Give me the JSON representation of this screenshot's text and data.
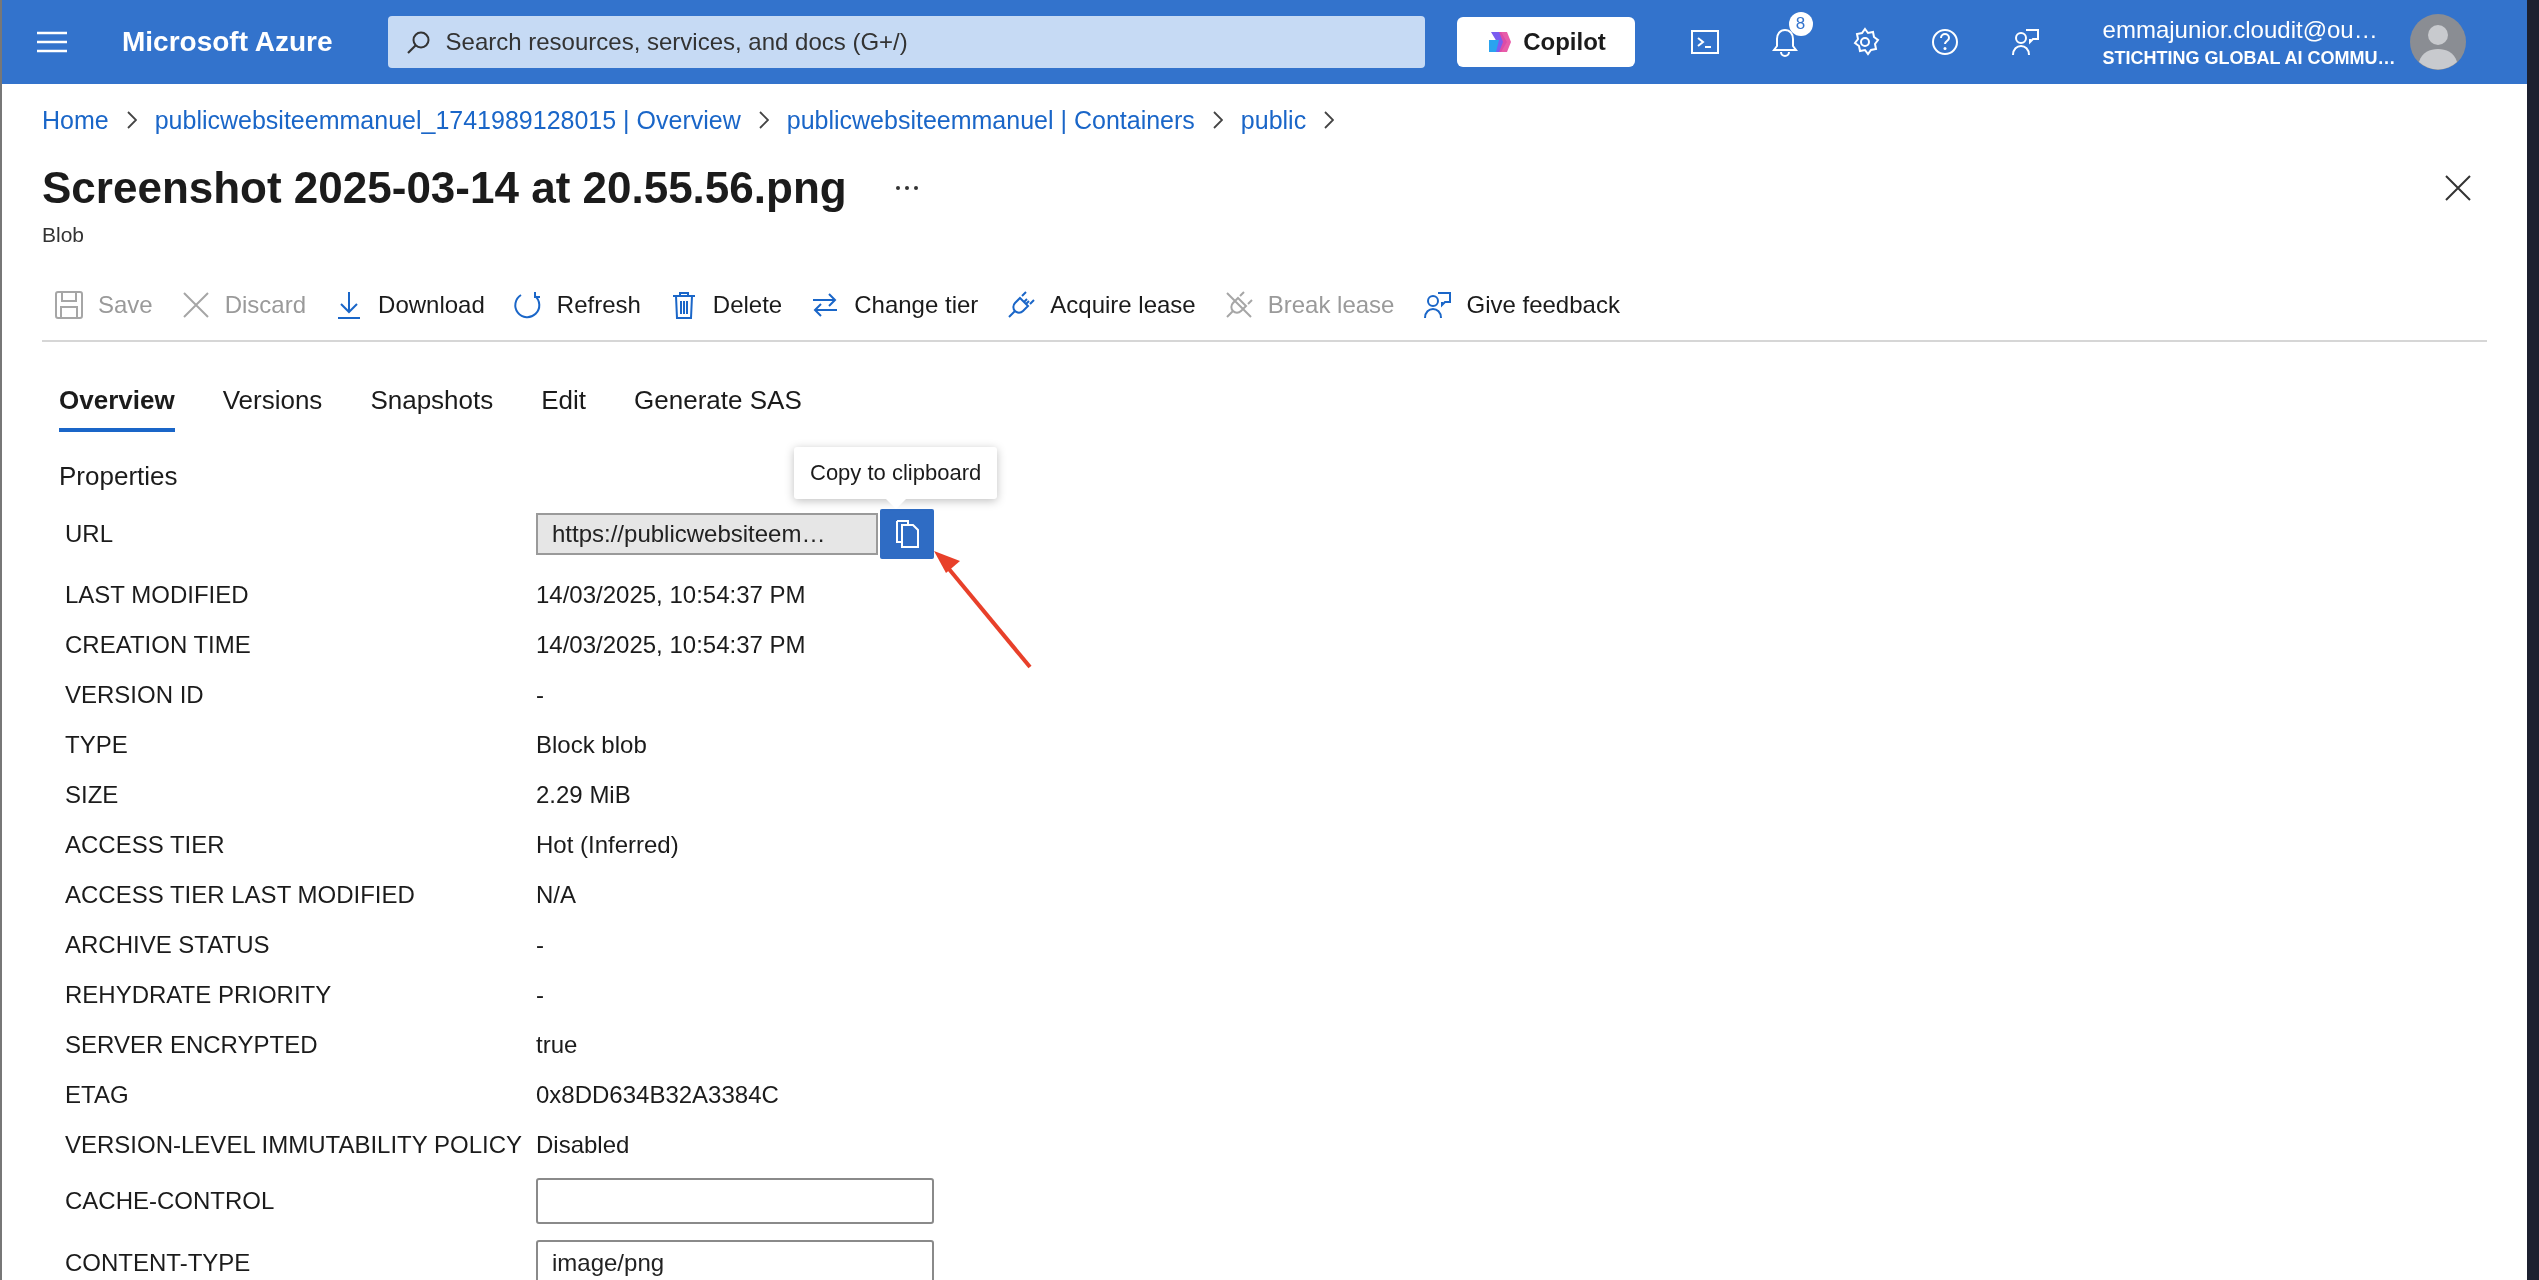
{
  "top_bar": {
    "title": "Microsoft Azure",
    "search": {
      "placeholder": "Search resources, services, and docs (G+/)"
    },
    "copilot": "Copilot",
    "notifications_badge": "8",
    "user": {
      "name": "emmajunior.cloudit@ou…",
      "org": "STICHTING GLOBAL AI COMMU…"
    }
  },
  "breadcrumb": [
    "Home",
    "publicwebsiteemmanuel_1741989128015 | Overview",
    "publicwebsiteemmanuel | Containers",
    "public"
  ],
  "title": "Screenshot 2025-03-14 at 20.55.56.png",
  "subtitle": "Blob",
  "toolbar": [
    {
      "label": "Save",
      "disabled": true
    },
    {
      "label": "Discard",
      "disabled": true
    },
    {
      "label": "Download",
      "disabled": false
    },
    {
      "label": "Refresh",
      "disabled": false
    },
    {
      "label": "Delete",
      "disabled": false
    },
    {
      "label": "Change tier",
      "disabled": false
    },
    {
      "label": "Acquire lease",
      "disabled": false
    },
    {
      "label": "Break lease",
      "disabled": true
    },
    {
      "label": "Give feedback",
      "disabled": false
    }
  ],
  "tabs": [
    {
      "label": "Overview",
      "selected": true
    },
    {
      "label": "Versions",
      "selected": false
    },
    {
      "label": "Snapshots",
      "selected": false
    },
    {
      "label": "Edit",
      "selected": false
    },
    {
      "label": "Generate SAS",
      "selected": false
    }
  ],
  "properties": {
    "heading": "Properties",
    "tooltip": "Copy to clipboard",
    "rows": [
      {
        "kind": "copy",
        "label": "URL",
        "value": "https://publicwebsiteem…"
      },
      {
        "kind": "text",
        "label": "LAST MODIFIED",
        "value": "14/03/2025, 10:54:37 PM"
      },
      {
        "kind": "text",
        "label": "CREATION TIME",
        "value": "14/03/2025, 10:54:37 PM"
      },
      {
        "kind": "text",
        "label": "VERSION ID",
        "value": "-"
      },
      {
        "kind": "text",
        "label": "TYPE",
        "value": "Block blob"
      },
      {
        "kind": "text",
        "label": "SIZE",
        "value": "2.29 MiB"
      },
      {
        "kind": "text",
        "label": "ACCESS TIER",
        "value": "Hot (Inferred)"
      },
      {
        "kind": "text",
        "label": "ACCESS TIER LAST MODIFIED",
        "value": "N/A"
      },
      {
        "kind": "text",
        "label": "ARCHIVE STATUS",
        "value": "-"
      },
      {
        "kind": "text",
        "label": "REHYDRATE PRIORITY",
        "value": "-"
      },
      {
        "kind": "text",
        "label": "SERVER ENCRYPTED",
        "value": "true"
      },
      {
        "kind": "text",
        "label": "ETAG",
        "value": "0x8DD634B32A3384C"
      },
      {
        "kind": "text",
        "label": "VERSION-LEVEL IMMUTABILITY POLICY",
        "value": "Disabled"
      },
      {
        "kind": "input",
        "label": "CACHE-CONTROL"
      },
      {
        "kind": "input",
        "label": "CONTENT-TYPE",
        "value": "image/png"
      }
    ]
  }
}
